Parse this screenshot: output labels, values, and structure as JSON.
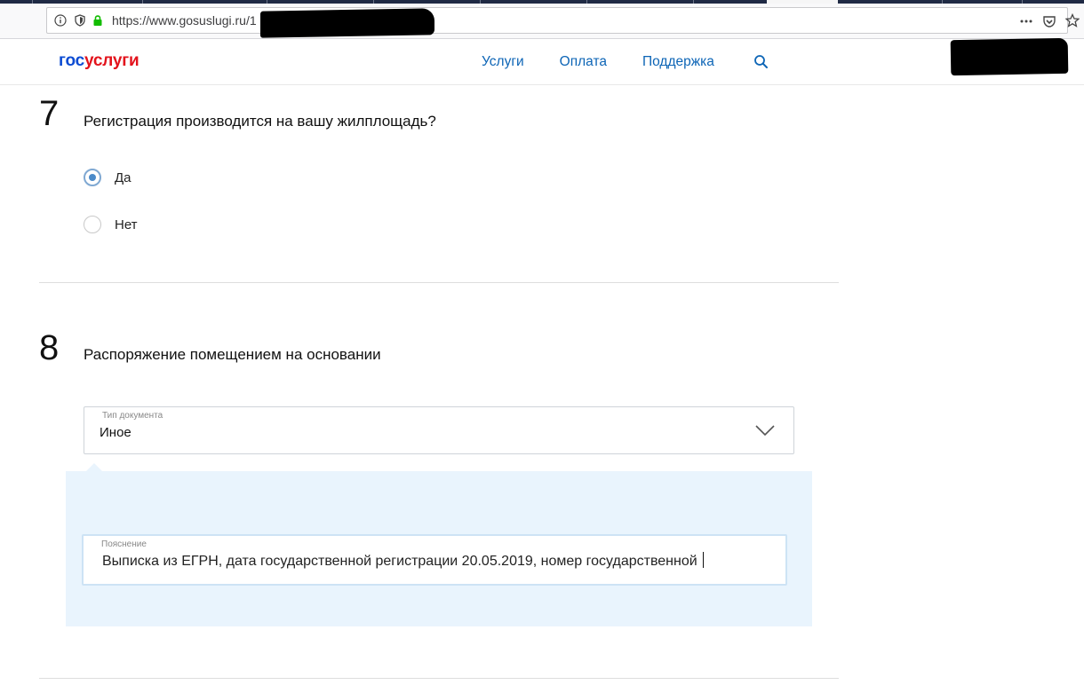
{
  "browser": {
    "url": "https://www.gosuslugi.ru/1"
  },
  "header": {
    "logo_part1": "гос",
    "logo_part2": "услуги",
    "nav": [
      "Услуги",
      "Оплата",
      "Поддержка"
    ]
  },
  "form": {
    "q7": {
      "number": "7",
      "title": "Регистрация производится на вашу жилплощадь?",
      "options": [
        {
          "label": "Да",
          "checked": true
        },
        {
          "label": "Нет",
          "checked": false
        }
      ]
    },
    "q8": {
      "number": "8",
      "title": "Распоряжение помещением на основании",
      "doc_type": {
        "label": "Тип документа",
        "value": "Иное"
      },
      "explanation": {
        "label": "Пояснение",
        "value": "Выписка из ЕГРН, дата государственной регистрации 20.05.2019, номер государственной"
      }
    }
  },
  "colors": {
    "logo_blue": "#0d4cd3",
    "logo_red": "#e3131c",
    "link_blue": "#0d65b6",
    "panel_bg": "#e9f4fd"
  }
}
